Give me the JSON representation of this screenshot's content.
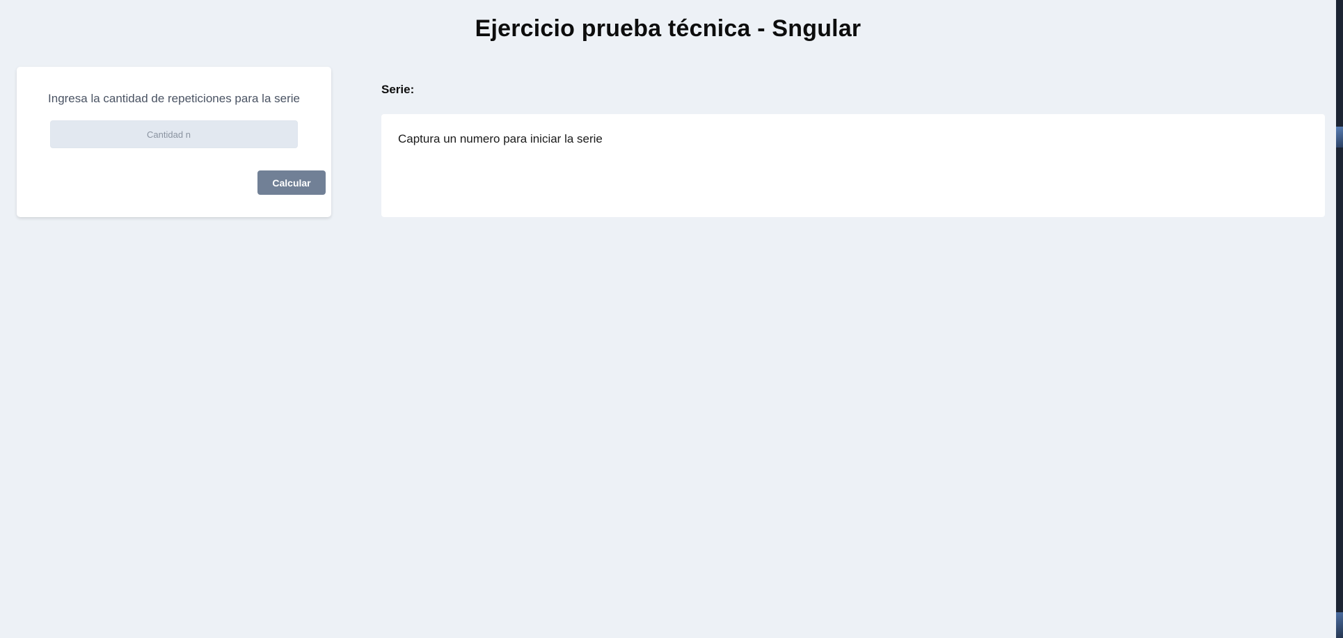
{
  "header": {
    "title": "Ejercicio prueba técnica - Sngular"
  },
  "input_card": {
    "prompt": "Ingresa la cantidad de repeticiones para la serie",
    "input": {
      "value": "",
      "placeholder": "Cantidad n"
    },
    "button_label": "Calcular"
  },
  "series": {
    "label": "Serie:",
    "message": "Captura un numero para iniciar la serie"
  },
  "colors": {
    "background": "#edf1f6",
    "button": "#718096",
    "input_background": "#e2e8f0",
    "card": "#ffffff"
  }
}
